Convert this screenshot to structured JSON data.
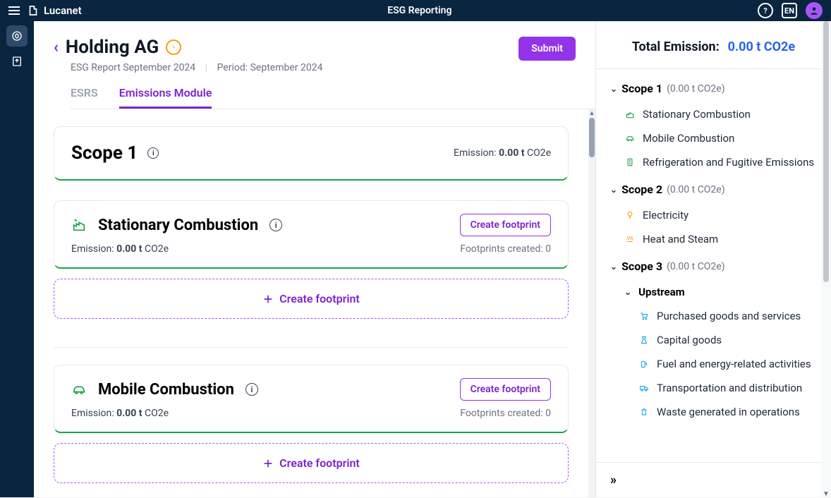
{
  "topbar": {
    "brand": "Lucanet",
    "title": "ESG Reporting",
    "lang": "EN"
  },
  "header": {
    "company": "Holding AG",
    "report_name": "ESG Report September 2024",
    "period_label": "Period: September 2024",
    "submit": "Submit"
  },
  "tabs": {
    "esrs": "ESRS",
    "emissions": "Emissions Module"
  },
  "scope1": {
    "title": "Scope 1",
    "emission_label": "Emission:",
    "emission_value": "0.00 t",
    "emission_unit": "CO2e"
  },
  "cat_stationary": {
    "title": "Stationary Combustion",
    "emission_label": "Emission:",
    "emission_value": "0.00 t",
    "emission_unit": "CO2e",
    "create": "Create footprint",
    "footprints_label": "Footprints created: 0"
  },
  "cat_mobile": {
    "title": "Mobile Combustion",
    "emission_label": "Emission:",
    "emission_value": "0.00 t",
    "emission_unit": "CO2e",
    "create": "Create footprint",
    "footprints_label": "Footprints created: 0"
  },
  "dashed": {
    "create": "Create footprint"
  },
  "sidebar": {
    "total_label": "Total Emission:",
    "total_value": "0.00 t CO2e",
    "scope1": {
      "label": "Scope 1",
      "value": "(0.00 t CO2e)"
    },
    "scope1_items": {
      "stationary": "Stationary Combustion",
      "mobile": "Mobile Combustion",
      "refrigeration": "Refrigeration and Fugitive Emissions"
    },
    "scope2": {
      "label": "Scope 2",
      "value": "(0.00 t CO2e)"
    },
    "scope2_items": {
      "electricity": "Electricity",
      "heat": "Heat and Steam"
    },
    "scope3": {
      "label": "Scope 3",
      "value": "(0.00 t CO2e)"
    },
    "upstream_label": "Upstream",
    "upstream_items": {
      "purchased": "Purchased goods and services",
      "capital": "Capital goods",
      "fuel": "Fuel and energy-related activities",
      "transport": "Transportation and distribution",
      "waste": "Waste generated in operations"
    }
  }
}
